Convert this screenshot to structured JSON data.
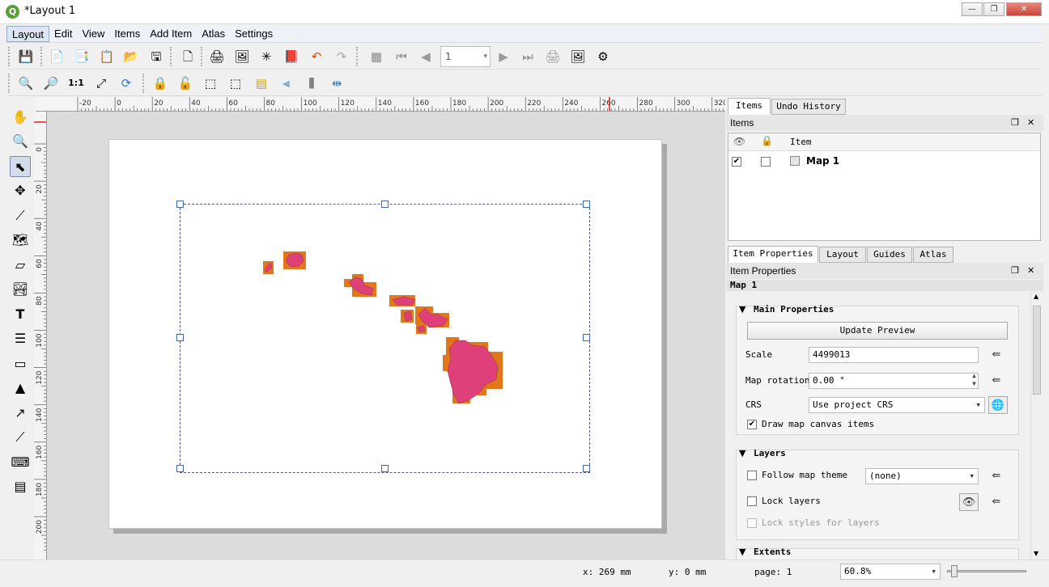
{
  "window": {
    "title": "*Layout 1",
    "app_icon": "Q",
    "controls": {
      "minimize": "—",
      "maximize": "❐",
      "close": "✕"
    }
  },
  "menubar": {
    "items": [
      "Layout",
      "Edit",
      "View",
      "Items",
      "Add Item",
      "Atlas",
      "Settings"
    ]
  },
  "toolbar": {
    "page_number": "1"
  },
  "rulers": {
    "top_labels": [
      "-20",
      "0",
      "20",
      "40",
      "60",
      "80",
      "100",
      "120",
      "140",
      "160",
      "180",
      "200",
      "220",
      "240",
      "260",
      "280",
      "300",
      "320"
    ],
    "left_labels": [
      "0",
      "20",
      "40",
      "60",
      "80",
      "100",
      "120",
      "140",
      "160",
      "180",
      "200"
    ]
  },
  "dock": {
    "top_tabs": [
      "Items",
      "Undo History"
    ],
    "items_panel": {
      "title": "Items",
      "column_header": "Item",
      "rows": [
        {
          "name": "Map 1",
          "visible": true,
          "locked": false
        }
      ]
    },
    "props_tabs": [
      "Item Properties",
      "Layout",
      "Guides",
      "Atlas"
    ],
    "props_panel": {
      "title": "Item Properties",
      "item_name": "Map 1",
      "main_properties": {
        "title": "Main Properties",
        "update_preview": "Update Preview",
        "scale_label": "Scale",
        "scale_value": "4499013",
        "rotation_label": "Map rotation",
        "rotation_value": "0.00 °",
        "crs_label": "CRS",
        "crs_value": "Use project CRS",
        "draw_canvas_items": "Draw map canvas items",
        "draw_canvas_items_checked": true
      },
      "layers": {
        "title": "Layers",
        "follow_theme": "Follow map theme",
        "theme_value": "(none)",
        "lock_layers": "Lock layers",
        "lock_styles": "Lock styles for layers"
      },
      "extents": {
        "title": "Extents"
      }
    },
    "panel_buttons": {
      "float": "❐",
      "close": "✕"
    }
  },
  "statusbar": {
    "x": "x: 269 mm",
    "y": "y: 0 mm",
    "page": "page: 1",
    "zoom": "60.8%"
  },
  "colors": {
    "island_fill": "#e0407a",
    "island_outline": "#e2761a",
    "map_frame": "#5a5a8a",
    "handle": "#3a6ab0"
  }
}
